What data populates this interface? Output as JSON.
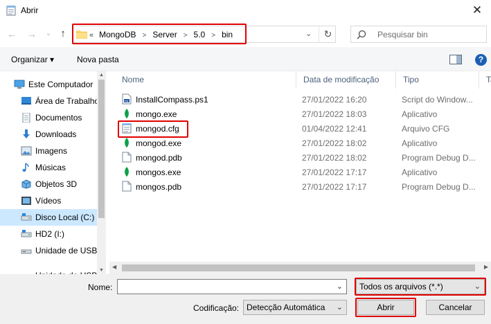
{
  "window": {
    "title": "Abrir",
    "close_glyph": "✕"
  },
  "nav": {
    "back_icon": "←",
    "forward_icon": "→",
    "history_icon": "⌄",
    "up_icon": "↑",
    "breadcrumb": [
      "MongoDB",
      "Server",
      "5.0",
      "bin"
    ],
    "overflow": "«",
    "refresh_icon": "↻",
    "search_placeholder": "Pesquisar bin"
  },
  "toolbar": {
    "organize": "Organizar ▾",
    "new_folder": "Nova pasta"
  },
  "sidebar": {
    "items": [
      {
        "label": "Este Computador",
        "icon": "computer-icon"
      },
      {
        "label": "Área de Trabalho",
        "icon": "desktop-icon"
      },
      {
        "label": "Documentos",
        "icon": "documents-icon"
      },
      {
        "label": "Downloads",
        "icon": "downloads-icon"
      },
      {
        "label": "Imagens",
        "icon": "pictures-icon"
      },
      {
        "label": "Músicas",
        "icon": "music-icon"
      },
      {
        "label": "Objetos 3D",
        "icon": "objects3d-icon"
      },
      {
        "label": "Vídeos",
        "icon": "videos-icon"
      },
      {
        "label": "Disco Local (C:)",
        "icon": "drive-icon"
      },
      {
        "label": "HD2 (I:)",
        "icon": "drive-icon"
      },
      {
        "label": "Unidade de USB",
        "icon": "usb-drive-icon"
      },
      {
        "label": "Unidade de USB (I:)",
        "icon": "usb-drive-icon"
      }
    ]
  },
  "columns": {
    "name": "Nome",
    "date": "Data de modificação",
    "type": "Tipo",
    "size": "Ta"
  },
  "files": [
    {
      "name": "InstallCompass.ps1",
      "date": "27/01/2022 16:20",
      "type": "Script do Window...",
      "icon": "script"
    },
    {
      "name": "mongo.exe",
      "date": "27/01/2022 18:03",
      "type": "Aplicativo",
      "icon": "leaf"
    },
    {
      "name": "mongod.cfg",
      "date": "01/04/2022 12:41",
      "type": "Arquivo CFG",
      "icon": "cfg"
    },
    {
      "name": "mongod.exe",
      "date": "27/01/2022 18:02",
      "type": "Aplicativo",
      "icon": "leaf"
    },
    {
      "name": "mongod.pdb",
      "date": "27/01/2022 18:02",
      "type": "Program Debug D...",
      "icon": "blank"
    },
    {
      "name": "mongos.exe",
      "date": "27/01/2022 17:17",
      "type": "Aplicativo",
      "icon": "leaf"
    },
    {
      "name": "mongos.pdb",
      "date": "27/01/2022 17:17",
      "type": "Program Debug D...",
      "icon": "blank"
    }
  ],
  "bottom": {
    "name_label": "Nome:",
    "name_value": "",
    "filter": "Todos os arquivos  (*.*)",
    "encoding_label": "Codificação:",
    "encoding_value": "Detecção Automática",
    "open": "Abrir",
    "cancel": "Cancelar"
  },
  "colors": {
    "highlight": "#e00000",
    "selection": "#cce8ff",
    "leaf": "#13aa52"
  }
}
